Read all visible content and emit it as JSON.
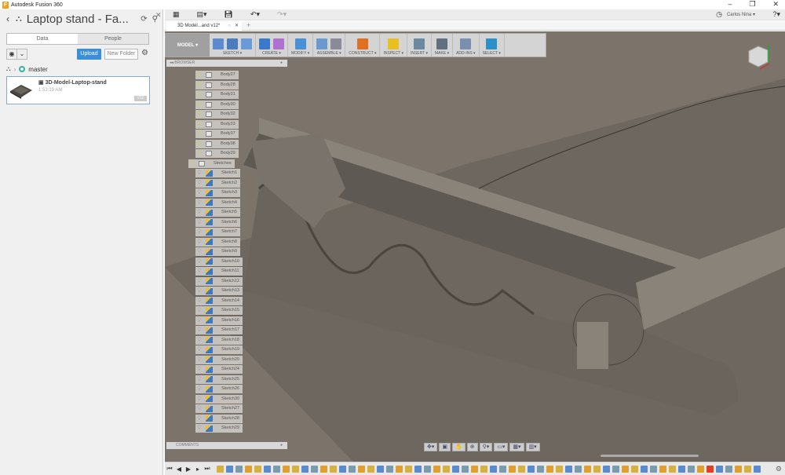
{
  "window": {
    "app_title": "Autodesk Fusion 360",
    "controls": [
      "–",
      "❐",
      "✕"
    ]
  },
  "data_panel": {
    "project_title": "Laptop stand - Fa...",
    "tabs": [
      {
        "label": "Data",
        "active": true
      },
      {
        "label": "People",
        "active": false
      }
    ],
    "upload_label": "Upload",
    "new_folder_label": "New Folder",
    "branch": "master",
    "file": {
      "name": "3D-Model-Laptop-stand",
      "time": "1:53:19 AM",
      "version": "V12"
    }
  },
  "quick_access": {
    "user": "Carlos Nina ▾"
  },
  "document_tab": {
    "label": "3D Model...and v12*"
  },
  "ribbon": {
    "workspace": "MODEL ▾",
    "groups": [
      {
        "label": "SKETCH ▾",
        "icons": [
          "#5a8ad0",
          "#4a7ac0",
          "#6a9ad8"
        ]
      },
      {
        "label": "CREATE ▾",
        "icons": [
          "#3a7ac8",
          "#b070d0"
        ]
      },
      {
        "label": "MODIFY ▾",
        "icons": [
          "#4a90d8"
        ]
      },
      {
        "label": "ASSEMBLE ▾",
        "icons": [
          "#6a9ad0",
          "#8a8a9a"
        ]
      },
      {
        "label": "CONSTRUCT ▾",
        "icons": [
          "#e07020"
        ]
      },
      {
        "label": "INSPECT ▾",
        "icons": [
          "#e8c020"
        ]
      },
      {
        "label": "INSERT ▾",
        "icons": [
          "#6a8aa0"
        ]
      },
      {
        "label": "MAKE ▾",
        "icons": [
          "#607080"
        ]
      },
      {
        "label": "ADD-INS ▾",
        "icons": [
          "#7a90b0"
        ]
      },
      {
        "label": "SELECT ▾",
        "icons": [
          "#2a90c8"
        ]
      }
    ]
  },
  "browser": {
    "title": "BROWSER",
    "bodies": [
      "Body27",
      "Body28",
      "Body31",
      "Body30",
      "Body32",
      "Body33",
      "Body37",
      "Body38",
      "Body39"
    ],
    "sketches_folder": "Sketches",
    "sketches": [
      "Sketch1",
      "Sketch2",
      "Sketch3",
      "Sketch4",
      "Sketch5",
      "Sketch6",
      "Sketch7",
      "Sketch8",
      "Sketch9",
      "Sketch10",
      "Sketch11",
      "Sketch12",
      "Sketch13",
      "Sketch14",
      "Sketch15",
      "Sketch16",
      "Sketch17",
      "Sketch18",
      "Sketch19",
      "Sketch20",
      "Sketch24",
      "Sketch25",
      "Sketch26",
      "Sketch30",
      "Sketch27",
      "Sketch28",
      "Sketch29"
    ]
  },
  "comments": {
    "title": "COMMENTS"
  },
  "colors": {
    "viewport": "#7c746b",
    "accent": "#3b8fd8"
  }
}
